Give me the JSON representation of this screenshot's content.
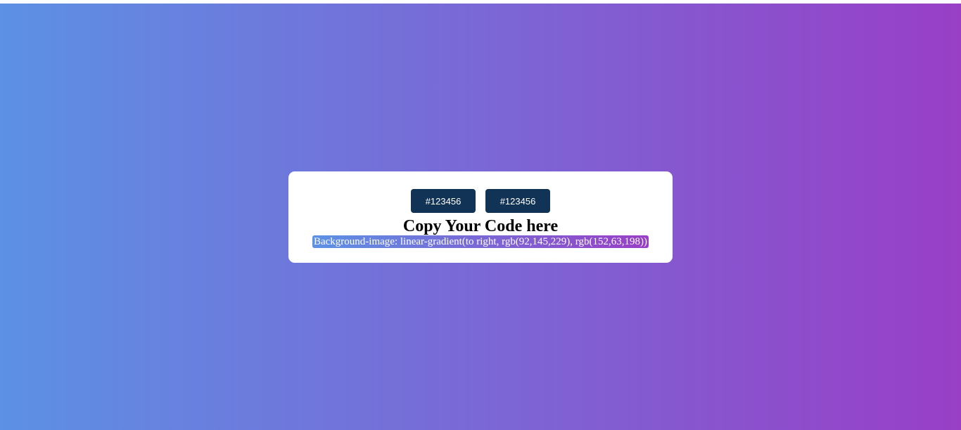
{
  "gradient": {
    "direction": "to right",
    "start_color": "#5c91e5",
    "end_color": "#983fc6"
  },
  "buttons": {
    "color_one_label": "#123456",
    "color_two_label": "#123456",
    "button_bg": "#113456"
  },
  "card": {
    "title": "Copy Your Code here",
    "code": "Background-image: linear-gradient(to right, rgb(92,145,229), rgb(152,63,198))"
  }
}
